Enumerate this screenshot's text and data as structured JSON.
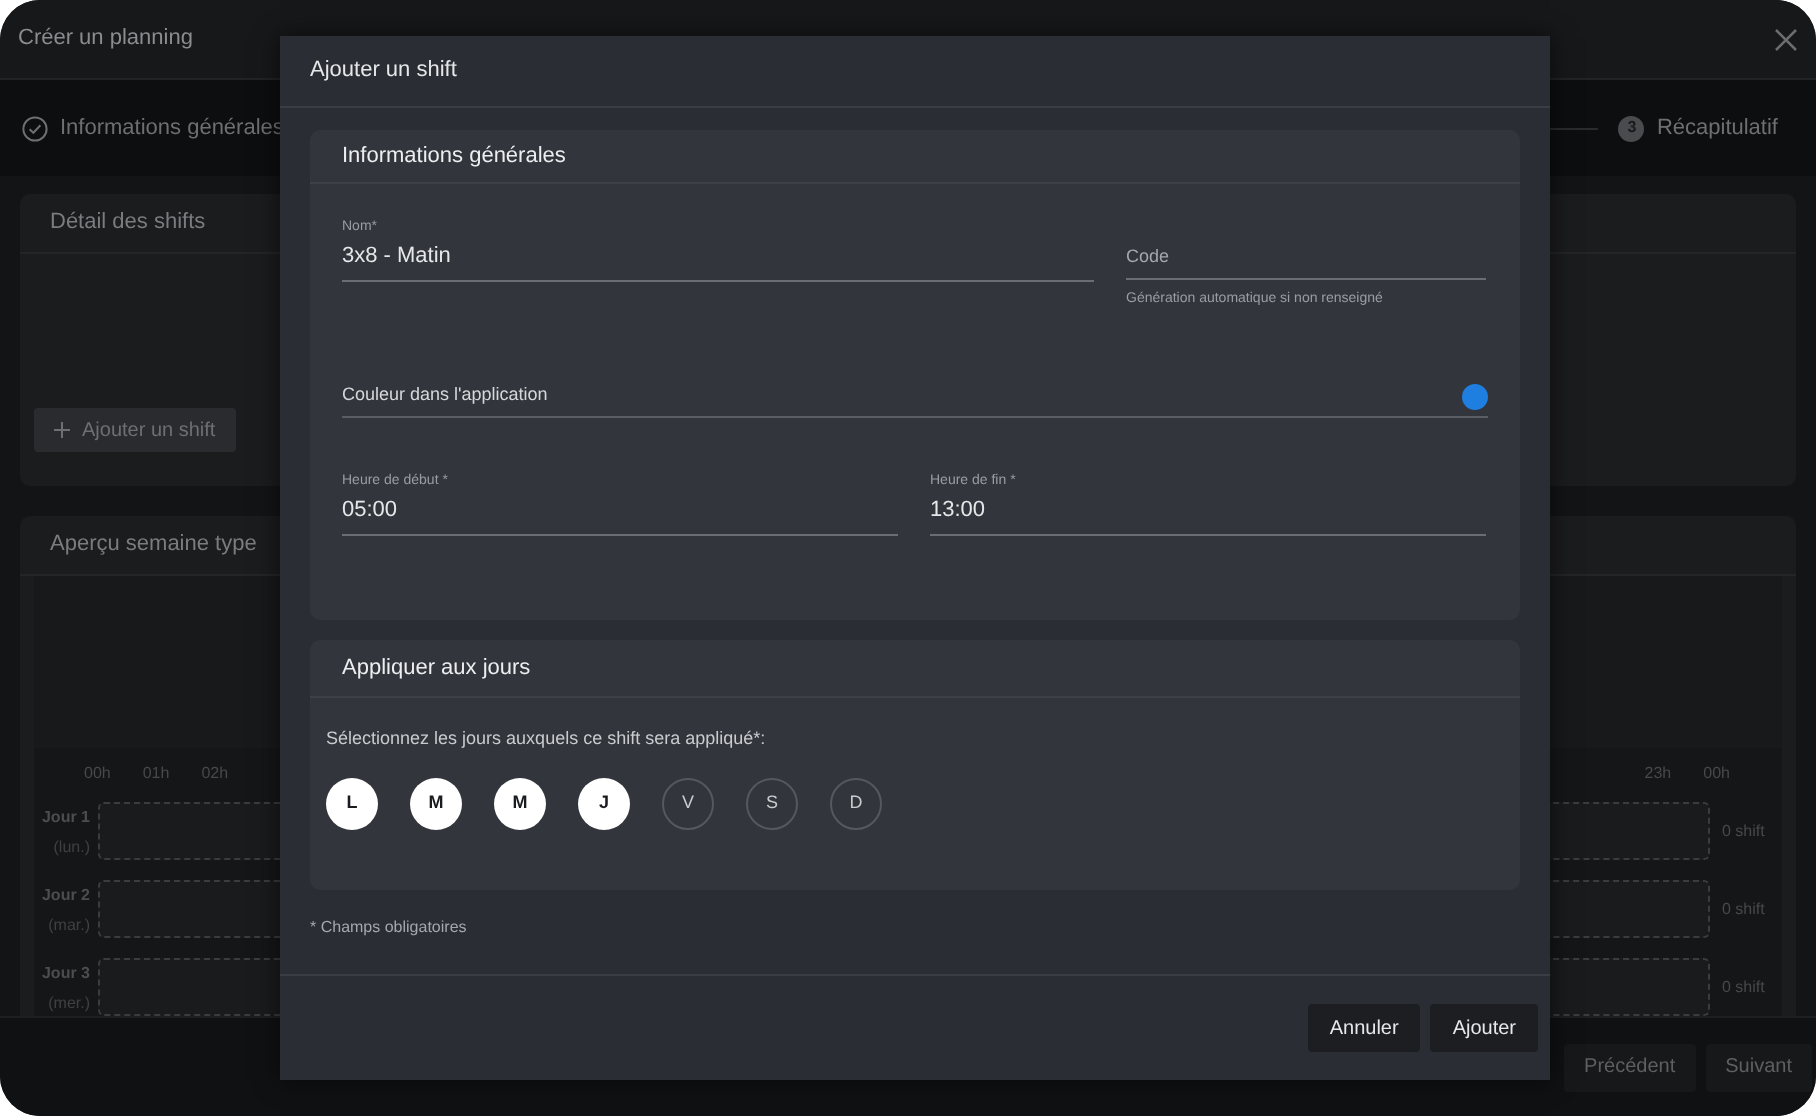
{
  "window": {
    "title": "Créer un planning"
  },
  "steps": [
    {
      "kind": "done",
      "label": "Informations générales"
    },
    {
      "kind": "pending",
      "number": "3",
      "label": "Récapitulatif"
    }
  ],
  "shift_details": {
    "title": "Détail des shifts",
    "add_button": "Ajouter un shift"
  },
  "week_preview": {
    "title": "Aperçu semaine type",
    "hours_left": [
      "00h",
      "01h",
      "02h"
    ],
    "hours_right": [
      "23h",
      "00h"
    ],
    "days": [
      {
        "label": "Jour 1",
        "weekday": "(lun.)",
        "count": "0 shift"
      },
      {
        "label": "Jour 2",
        "weekday": "(mar.)",
        "count": "0 shift"
      },
      {
        "label": "Jour 3",
        "weekday": "(mer.)",
        "count": "0 shift"
      }
    ]
  },
  "footer_buttons": [
    "Précédent",
    "Suivant"
  ],
  "dialog": {
    "title": "Ajouter un shift",
    "general": {
      "title": "Informations générales",
      "name": {
        "label": "Nom*",
        "value": "3x8 - Matin"
      },
      "code": {
        "placeholder": "Code",
        "hint": "Génération automatique si non renseigné"
      },
      "color": {
        "label": "Couleur dans l'application",
        "color": "#1e7fe0"
      },
      "start": {
        "label": "Heure de début *",
        "value": "05:00"
      },
      "end": {
        "label": "Heure de fin *",
        "value": "13:00"
      }
    },
    "days": {
      "title": "Appliquer aux jours",
      "prompt": "Sélectionnez les jours auxquels ce shift sera appliqué*:",
      "items": [
        {
          "label": "L",
          "selected": true
        },
        {
          "label": "M",
          "selected": true
        },
        {
          "label": "M",
          "selected": true
        },
        {
          "label": "J",
          "selected": true
        },
        {
          "label": "V",
          "selected": false
        },
        {
          "label": "S",
          "selected": false
        },
        {
          "label": "D",
          "selected": false
        }
      ]
    },
    "required_note": "* Champs obligatoires",
    "buttons": [
      "Annuler",
      "Ajouter"
    ]
  }
}
